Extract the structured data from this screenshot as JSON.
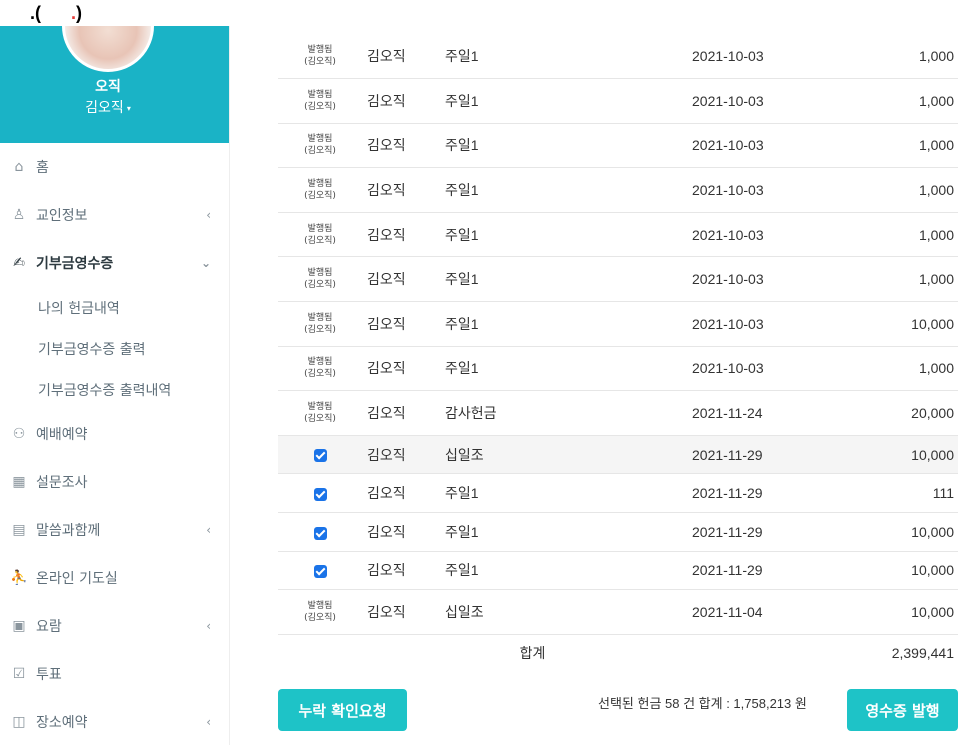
{
  "top_artifact": {
    "left": ".(",
    "dot": ".",
    "right": ")"
  },
  "profile": {
    "name": "오직",
    "user": "김오직",
    "caret": "▾"
  },
  "menu": [
    {
      "label": "홈",
      "icon": "home-icon",
      "glyph": "⌂",
      "chevron": ""
    },
    {
      "label": "교인정보",
      "icon": "user-icon",
      "glyph": "♙",
      "chevron": "‹"
    },
    {
      "label": "기부금영수증",
      "icon": "donation-icon",
      "glyph": "✍",
      "chevron": "⌄"
    },
    {
      "label": "예배예약",
      "icon": "reservation-icon",
      "glyph": "⚇",
      "chevron": ""
    },
    {
      "label": "설문조사",
      "icon": "survey-icon",
      "glyph": "▦",
      "chevron": ""
    },
    {
      "label": "말씀과함께",
      "icon": "book-icon",
      "glyph": "▤",
      "chevron": "‹"
    },
    {
      "label": "온라인 기도실",
      "icon": "pray-icon",
      "glyph": "⛹",
      "chevron": ""
    },
    {
      "label": "요람",
      "icon": "directory-icon",
      "glyph": "▣",
      "chevron": "‹"
    },
    {
      "label": "투표",
      "icon": "vote-icon",
      "glyph": "☑",
      "chevron": ""
    },
    {
      "label": "장소예약",
      "icon": "place-icon",
      "glyph": "◫",
      "chevron": "‹"
    }
  ],
  "submenu": [
    "나의 헌금내역",
    "기부금영수증 출력",
    "기부금영수증 출력내역"
  ],
  "issued_label": "발행됨",
  "issued_by": "(김오직)",
  "rows": [
    {
      "status": "issued",
      "name": "김오직",
      "type": "주일1",
      "date": "2021-10-03",
      "amount": "1,000"
    },
    {
      "status": "issued",
      "name": "김오직",
      "type": "주일1",
      "date": "2021-10-03",
      "amount": "1,000"
    },
    {
      "status": "issued",
      "name": "김오직",
      "type": "주일1",
      "date": "2021-10-03",
      "amount": "1,000"
    },
    {
      "status": "issued",
      "name": "김오직",
      "type": "주일1",
      "date": "2021-10-03",
      "amount": "1,000"
    },
    {
      "status": "issued",
      "name": "김오직",
      "type": "주일1",
      "date": "2021-10-03",
      "amount": "1,000"
    },
    {
      "status": "issued",
      "name": "김오직",
      "type": "주일1",
      "date": "2021-10-03",
      "amount": "1,000"
    },
    {
      "status": "issued",
      "name": "김오직",
      "type": "주일1",
      "date": "2021-10-03",
      "amount": "10,000"
    },
    {
      "status": "issued",
      "name": "김오직",
      "type": "주일1",
      "date": "2021-10-03",
      "amount": "1,000"
    },
    {
      "status": "issued",
      "name": "김오직",
      "type": "감사헌금",
      "date": "2021-11-24",
      "amount": "20,000"
    },
    {
      "status": "checked",
      "name": "김오직",
      "type": "십일조",
      "date": "2021-11-29",
      "amount": "10,000"
    },
    {
      "status": "checked",
      "name": "김오직",
      "type": "주일1",
      "date": "2021-11-29",
      "amount": "111"
    },
    {
      "status": "checked",
      "name": "김오직",
      "type": "주일1",
      "date": "2021-11-29",
      "amount": "10,000"
    },
    {
      "status": "checked",
      "name": "김오직",
      "type": "주일1",
      "date": "2021-11-29",
      "amount": "10,000"
    },
    {
      "status": "issued",
      "name": "김오직",
      "type": "십일조",
      "date": "2021-11-04",
      "amount": "10,000"
    }
  ],
  "total": {
    "label": "합계",
    "amount": "2,399,441"
  },
  "footer": {
    "missing_button": "누락 확인요청",
    "summary": "선택된 헌금 58 건 합계 : 1,758,213 원",
    "receipt_button": "영수증 발행"
  },
  "colors": {
    "accent": "#1ec3c7",
    "profile_bg": "#1ab3c6",
    "checkbox": "#1a73e8"
  }
}
